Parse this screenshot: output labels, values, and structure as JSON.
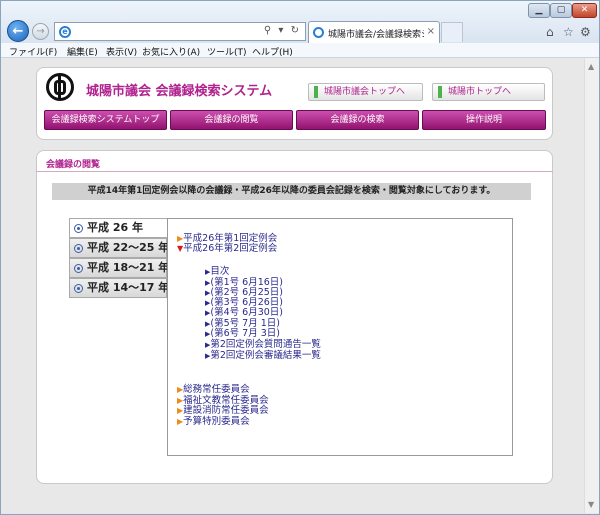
{
  "browser": {
    "address_value": "",
    "tab_title": "城陽市議会/会議録検索シ...",
    "tab_close": "×",
    "menu": [
      "ファイル(F)",
      "編集(E)",
      "表示(V)",
      "お気に入り(A)",
      "ツール(T)",
      "ヘルプ(H)"
    ]
  },
  "header": {
    "site_title": "城陽市議会 会議録検索システム",
    "links": [
      "城陽市議会トップへ",
      "城陽市トップへ"
    ],
    "nav": [
      "会議録検索システムトップ",
      "会議録の閲覧",
      "会議録の検索",
      "操作説明"
    ]
  },
  "content": {
    "section_title": "会議録の閲覧",
    "notice": "平成14年第1回定例会以降の会議録・平成26年以降の委員会記録を検索・閲覧対象にしております。",
    "year_tabs": [
      "平成 26 年",
      "平成 22～25 年",
      "平成 18～21 年",
      "平成 14～17 年"
    ],
    "sessions": [
      {
        "label": "平成26年第1回定例会",
        "expanded": false
      },
      {
        "label": "平成26年第2回定例会",
        "expanded": true
      }
    ],
    "session_items": [
      "目次",
      "(第1号 6月16日)",
      "(第2号 6月25日)",
      "(第3号 6月26日)",
      "(第4号 6月30日)",
      "(第5号 7月 1日)",
      "(第6号 7月 3日)",
      "第2回定例会質問通告一覧",
      "第2回定例会審議結果一覧"
    ],
    "committees": [
      "総務常任委員会",
      "福祉文教常任委員会",
      "建設消防常任委員会",
      "予算特別委員会"
    ]
  }
}
